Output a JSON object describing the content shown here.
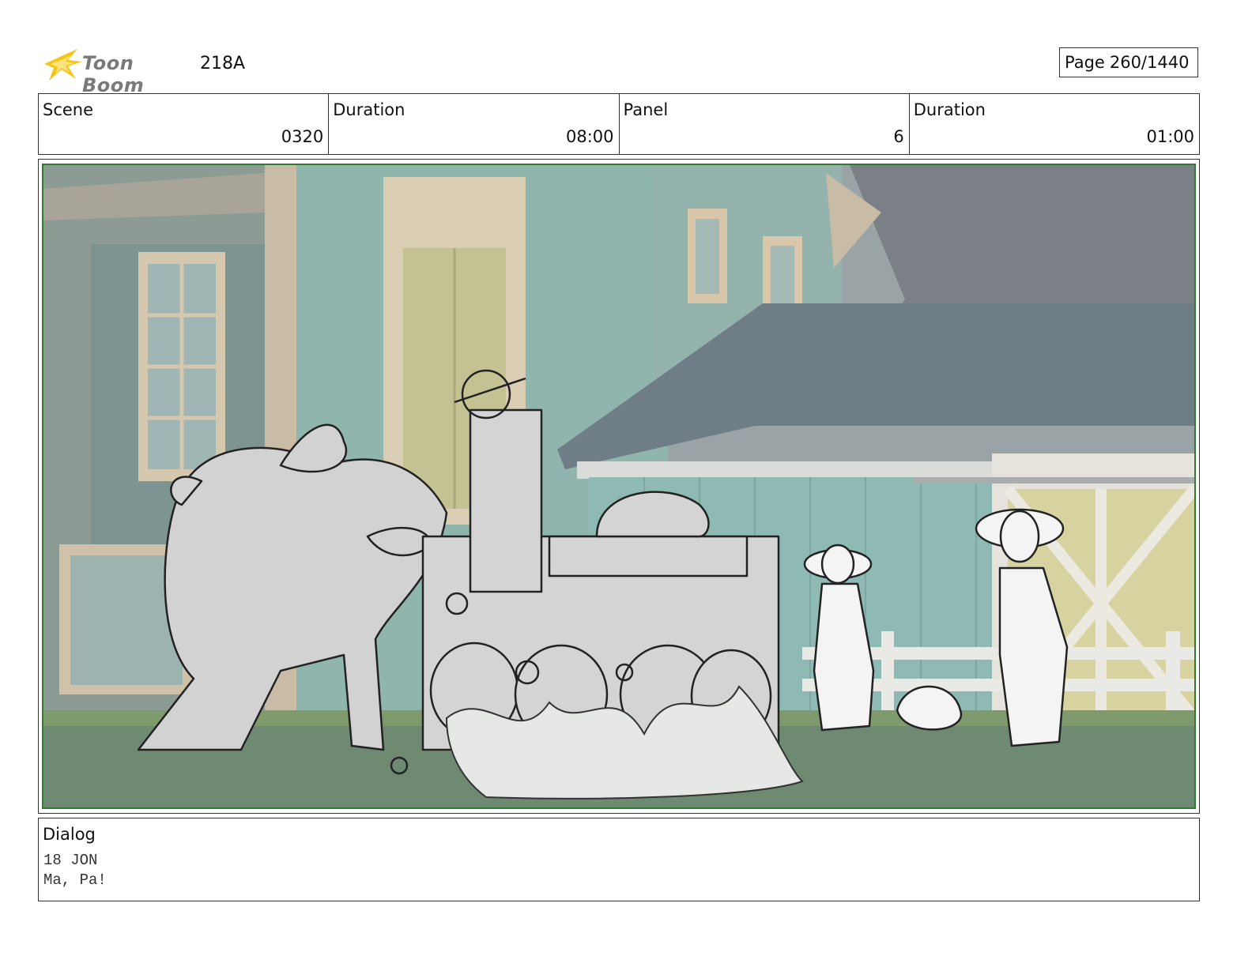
{
  "header": {
    "logo_text": "Toon Boom",
    "project_id": "218A",
    "page_label": "Page",
    "page_value": "260/1440"
  },
  "info": [
    {
      "label": "Scene",
      "value": "0320"
    },
    {
      "label": "Duration",
      "value": "08:00"
    },
    {
      "label": "Panel",
      "value": "6"
    },
    {
      "label": "Duration",
      "value": "01:00"
    }
  ],
  "dialog": {
    "title": "Dialog",
    "lines": [
      "18 JON",
      "Ma, Pa!"
    ]
  },
  "colors": {
    "logo_accent": "#f5c518",
    "panel_border": "#2e7d32",
    "wall_teal": "#8fb5ad",
    "roof_gray": "#6f7d86",
    "ground": "#6f8a73"
  }
}
